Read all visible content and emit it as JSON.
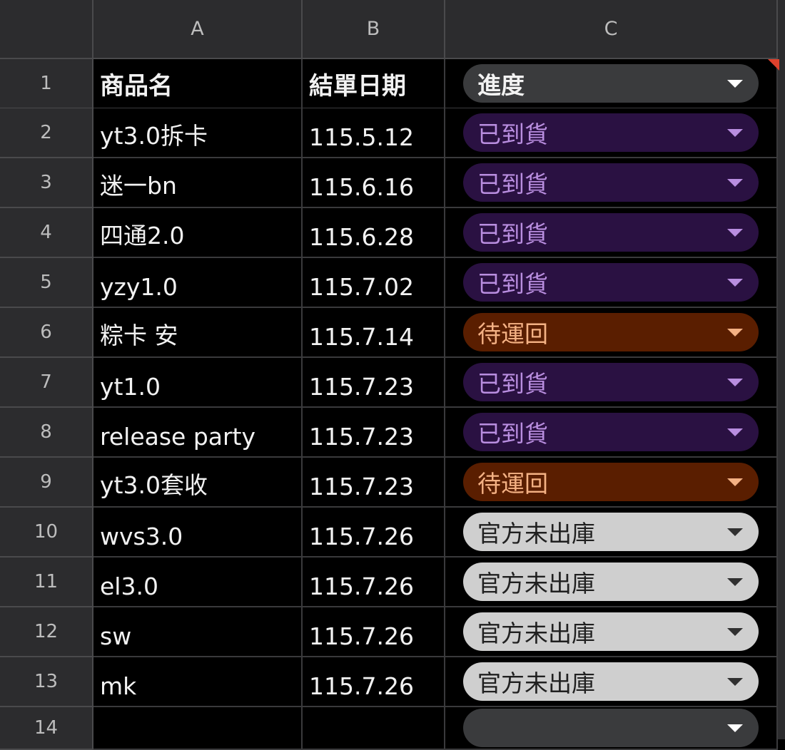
{
  "columns": [
    "A",
    "B",
    "C"
  ],
  "header_row": {
    "row": "1",
    "name": "商品名",
    "date": "結單日期",
    "status": "進度"
  },
  "rows": [
    {
      "row": "2",
      "name": "yt3.0拆卡",
      "date": "115.5.12",
      "status": "已到貨",
      "type": "purple"
    },
    {
      "row": "3",
      "name": "迷一bn",
      "date": "115.6.16",
      "status": "已到貨",
      "type": "purple"
    },
    {
      "row": "4",
      "name": "四通2.0",
      "date": "115.6.28",
      "status": "已到貨",
      "type": "purple"
    },
    {
      "row": "5",
      "name": "yzy1.0",
      "date": "115.7.02",
      "status": "已到貨",
      "type": "purple"
    },
    {
      "row": "6",
      "name": "粽卡 安",
      "date": "115.7.14",
      "status": "待運回",
      "type": "orange"
    },
    {
      "row": "7",
      "name": "yt1.0",
      "date": "115.7.23",
      "status": "已到貨",
      "type": "purple"
    },
    {
      "row": "8",
      "name": "release party",
      "date": "115.7.23",
      "status": "已到貨",
      "type": "purple"
    },
    {
      "row": "9",
      "name": "yt3.0套收",
      "date": "115.7.23",
      "status": "待運回",
      "type": "orange"
    },
    {
      "row": "10",
      "name": "wvs3.0",
      "date": "115.7.26",
      "status": "官方未出庫",
      "type": "gray"
    },
    {
      "row": "11",
      "name": "el3.0",
      "date": "115.7.26",
      "status": "官方未出庫",
      "type": "gray"
    },
    {
      "row": "12",
      "name": "sw",
      "date": "115.7.26",
      "status": "官方未出庫",
      "type": "gray"
    },
    {
      "row": "13",
      "name": "mk",
      "date": "115.7.26",
      "status": "官方未出庫",
      "type": "gray"
    },
    {
      "row": "14",
      "name": "",
      "date": "",
      "status": "",
      "type": "empty"
    }
  ],
  "colors": {
    "purple_bg": "#2a1142",
    "purple_text": "#b98ee0",
    "orange_bg": "#5a1e00",
    "orange_text": "#f4b184",
    "gray_bg": "#cfcfcf",
    "gray_text": "#202020",
    "header_bg": "#2c2c2e"
  },
  "icons": {
    "dropdown": "chevron-down-icon",
    "comment_marker": "comment-indicator-icon"
  }
}
